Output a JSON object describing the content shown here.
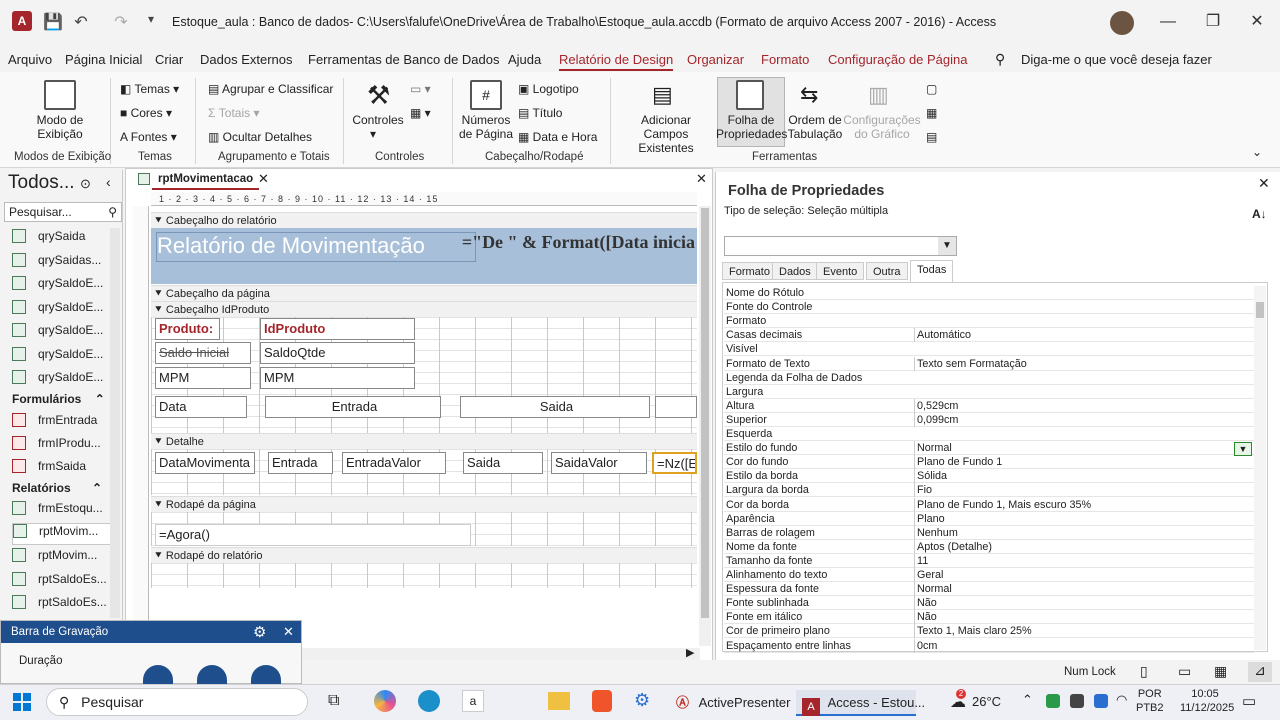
{
  "titlebar": {
    "doc_title": "Estoque_aula : Banco de dados- C:\\Users\\falufe\\OneDrive\\Área de Trabalho\\Estoque_aula.accdb (Formato de arquivo Access 2007 - 2016)  -  Access"
  },
  "menu": {
    "items": [
      "Arquivo",
      "Página Inicial",
      "Criar",
      "Dados Externos",
      "Ferramentas de Banco de Dados",
      "Ajuda",
      "Relatório de Design",
      "Organizar",
      "Formato",
      "Configuração de Página"
    ],
    "tell_me": "Diga-me o que você deseja fazer"
  },
  "ribbon": {
    "modo_exibicao": "Modo de Exibição",
    "temas": "Temas",
    "cores": "Cores",
    "fontes": "Fontes",
    "agrupar": "Agrupar e Classificar",
    "totais": "Totais",
    "ocultar": "Ocultar Detalhes",
    "controles": "Controles",
    "numeros": "Números de Página",
    "logotipo": "Logotipo",
    "titulo": "Título",
    "data_hora": "Data e Hora",
    "adicionar_campos": "Adicionar Campos Existentes",
    "folha_prop": "Folha de Propriedades",
    "ordem_tab": "Ordem de Tabulação",
    "config_grafico": "Configurações do Gráfico",
    "groups": [
      "Modos de Exibição",
      "Temas",
      "Agrupamento e Totais",
      "Controles",
      "Cabeçalho/Rodapé",
      "Ferramentas"
    ]
  },
  "nav": {
    "title": "Todos...",
    "search_placeholder": "Pesquisar...",
    "queries": [
      "qrySaida",
      "qrySaidas...",
      "qrySaldoE...",
      "qrySaldoE...",
      "qrySaldoE...",
      "qrySaldoE...",
      "qrySaldoE..."
    ],
    "forms_header": "Formulários",
    "forms": [
      "frmEntrada",
      "frmIProdu...",
      "frmSaida"
    ],
    "reports_header": "Relatórios",
    "reports": [
      "frmEstoqu...",
      "rptMovim...",
      "rptMovim...",
      "rptSaldoEs...",
      "rptSaldoEs..."
    ]
  },
  "doc": {
    "tab": "rptMovimentacao",
    "sections": [
      "Cabeçalho do relatório",
      "Cabeçalho da página",
      "Cabeçalho IdProduto",
      "Detalhe",
      "Rodapé da página",
      "Rodapé do relatório"
    ],
    "report_title": "Relatório de Movimentação",
    "title_expr": "=\"De \" & Format([Data inicia",
    "produto_label": "Produto:",
    "idproduto": "IdProduto",
    "saldo_inicial": "Saldo Inicial",
    "saldoqtde": "SaldoQtde",
    "mpm1": "MPM",
    "mpm2": "MPM",
    "h_data": "Data",
    "h_entrada": "Entrada",
    "h_saida": "Saida",
    "d_data": "DataMovimenta",
    "d_entrada": "Entrada",
    "d_entradavalor": "EntradaValor",
    "d_saida": "Saida",
    "d_saidavalor": "SaidaValor",
    "d_nz": "=Nz([En",
    "agora": "=Agora()",
    "ruler": "1 · 2 · 3 · 4 · 5 · 6 · 7 · 8 · 9 · 10 · 11 · 12 · 13 · 14 · 15"
  },
  "props": {
    "title": "Folha de Propriedades",
    "selection": "Tipo de seleção:  Seleção múltipla",
    "tabs": [
      "Formato",
      "Dados",
      "Evento",
      "Outra",
      "Todas"
    ],
    "rows": [
      [
        "Nome do Rótulo",
        ""
      ],
      [
        "Fonte do Controle",
        ""
      ],
      [
        "Formato",
        ""
      ],
      [
        "Casas decimais",
        "Automático"
      ],
      [
        "Visível",
        ""
      ],
      [
        "Formato de Texto",
        "Texto sem Formatação"
      ],
      [
        "Legenda da Folha de Dados",
        ""
      ],
      [
        "Largura",
        ""
      ],
      [
        "Altura",
        "0,529cm"
      ],
      [
        "Superior",
        "0,099cm"
      ],
      [
        "Esquerda",
        ""
      ],
      [
        "Estilo do fundo",
        "Normal"
      ],
      [
        "Cor do fundo",
        "Plano de Fundo 1"
      ],
      [
        "Estilo da borda",
        "Sólida"
      ],
      [
        "Largura da borda",
        "Fio"
      ],
      [
        "Cor da borda",
        "Plano de Fundo 1, Mais escuro 35%"
      ],
      [
        "Aparência",
        "Plano"
      ],
      [
        "Barras de rolagem",
        "Nenhum"
      ],
      [
        "Nome da fonte",
        "Aptos (Detalhe)"
      ],
      [
        "Tamanho da fonte",
        "11"
      ],
      [
        "Alinhamento do texto",
        "Geral"
      ],
      [
        "Espessura da fonte",
        "Normal"
      ],
      [
        "Fonte sublinhada",
        "Não"
      ],
      [
        "Fonte em itálico",
        "Não"
      ],
      [
        "Cor de primeiro plano",
        "Texto 1, Mais claro 25%"
      ],
      [
        "Espaçamento entre linhas",
        "0cm"
      ]
    ]
  },
  "status": {
    "numlock": "Num Lock"
  },
  "recording": {
    "title": "Barra de Gravação",
    "duracao": "Duração"
  },
  "taskbar": {
    "search": "Pesquisar",
    "activepresenter": "ActivePresenter",
    "access": "Access - Estou...",
    "temp": "26°C",
    "lang1": "POR",
    "lang2": "PTB2",
    "time": "10:05",
    "date": "11/12/2025",
    "badge": "2"
  }
}
